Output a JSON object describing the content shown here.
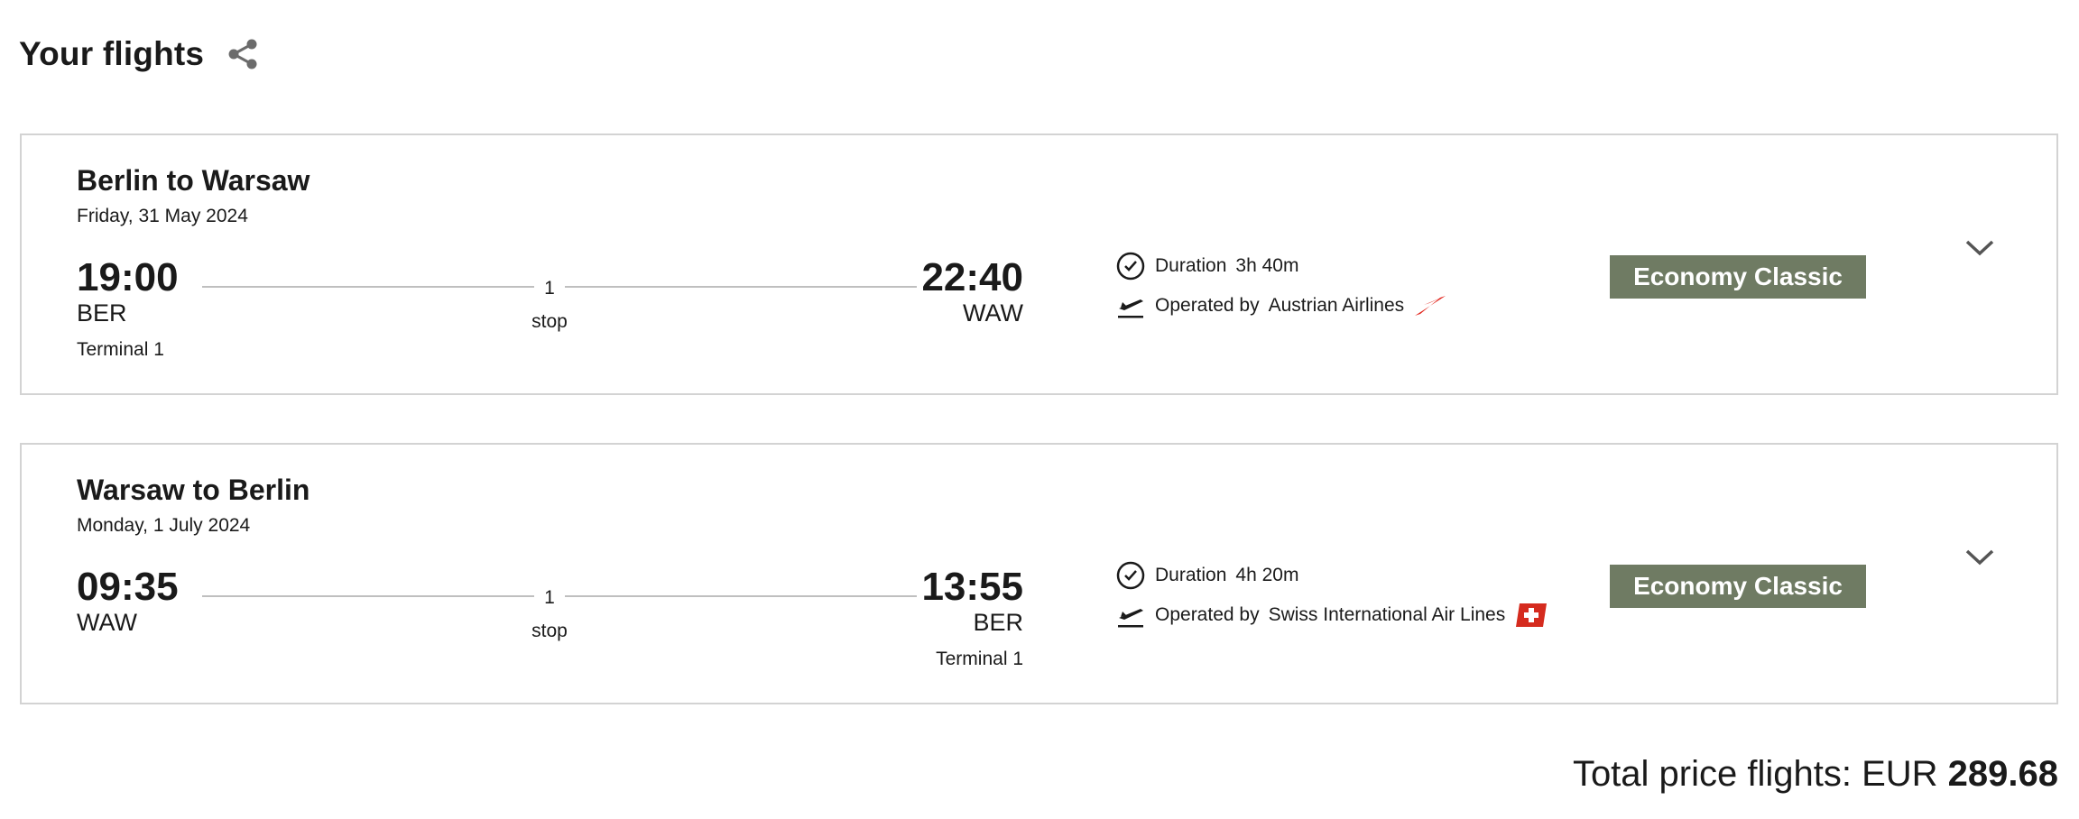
{
  "header": {
    "title": "Your flights",
    "share_icon": "share-icon"
  },
  "flights": [
    {
      "title": "Berlin to Warsaw",
      "date": "Friday, 31 May 2024",
      "departure": {
        "time": "19:00",
        "code": "BER",
        "terminal": "Terminal 1"
      },
      "arrival": {
        "time": "22:40",
        "code": "WAW",
        "terminal": ""
      },
      "stops": {
        "count": "1",
        "label": "stop"
      },
      "duration_label": "Duration",
      "duration": "3h 40m",
      "operated_label": "Operated by",
      "airline": "Austrian Airlines",
      "airline_logo": "austrian-airlines-logo",
      "fare_class": "Economy Classic"
    },
    {
      "title": "Warsaw to Berlin",
      "date": "Monday, 1 July 2024",
      "departure": {
        "time": "09:35",
        "code": "WAW",
        "terminal": ""
      },
      "arrival": {
        "time": "13:55",
        "code": "BER",
        "terminal": "Terminal 1"
      },
      "stops": {
        "count": "1",
        "label": "stop"
      },
      "duration_label": "Duration",
      "duration": "4h 20m",
      "operated_label": "Operated by",
      "airline": "Swiss International Air Lines",
      "airline_logo": "swiss-airlines-logo",
      "fare_class": "Economy Classic"
    }
  ],
  "total": {
    "label": "Total price flights: EUR",
    "amount": "289.68"
  },
  "colors": {
    "fare_badge": "#6f7b63",
    "austrian_red": "#e2231a",
    "swiss_red": "#d52b1e",
    "icon_gray": "#6b6b6b"
  }
}
